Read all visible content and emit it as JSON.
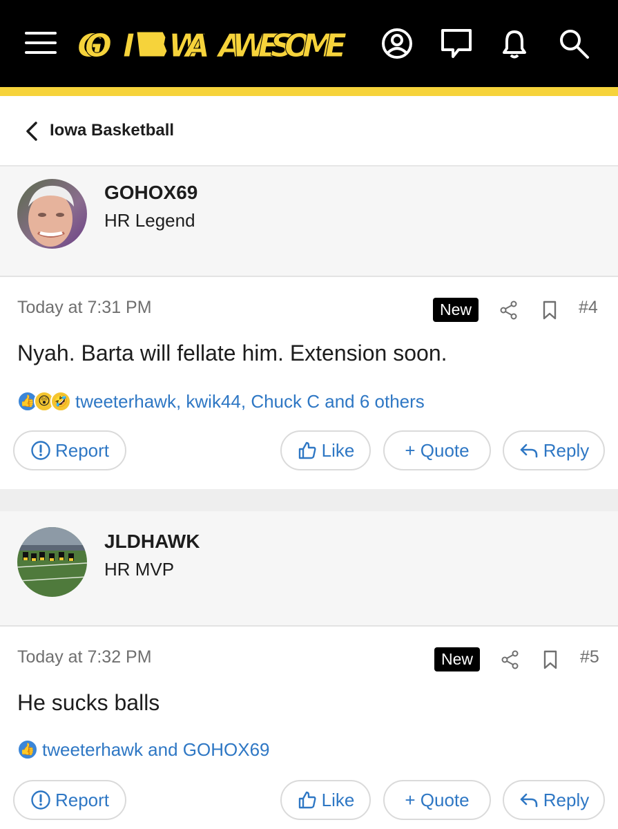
{
  "header": {
    "logo_text": "GO IOWA AWESOME",
    "icons": [
      "menu-icon",
      "account-icon",
      "chat-icon",
      "alert-icon",
      "search-icon"
    ],
    "colors": {
      "bar": "#000000",
      "accent": "#f6d33b"
    }
  },
  "breadcrumb": {
    "label": "Iowa Basketball"
  },
  "posts": [
    {
      "username": "GOHOX69",
      "user_title": "HR Legend",
      "timestamp": "Today at 7:31 PM",
      "badge": "New",
      "post_number": "#4",
      "message": "Nyah. Barta will fellate him. Extension soon.",
      "reaction_icons": [
        "like-icon",
        "wow-icon",
        "haha-icon"
      ],
      "reaction_users": "tweeterhawk, kwik44, Chuck C and 6 others",
      "actions": {
        "report": "Report",
        "like": "Like",
        "quote": "+ Quote",
        "reply": "Reply"
      }
    },
    {
      "username": "JLDHAWK",
      "user_title": "HR MVP",
      "timestamp": "Today at 7:32 PM",
      "badge": "New",
      "post_number": "#5",
      "message": "He sucks balls",
      "reaction_icons": [
        "like-icon"
      ],
      "reaction_users": "tweeterhawk and GOHOX69",
      "actions": {
        "report": "Report",
        "like": "Like",
        "quote": "+ Quote",
        "reply": "Reply"
      }
    }
  ]
}
